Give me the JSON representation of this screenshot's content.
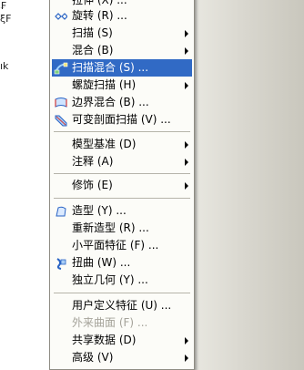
{
  "background": {
    "fragments": [
      "₣",
      "ξF",
      "ık"
    ]
  },
  "menu": {
    "items": [
      {
        "label": "拉伸 (X) ...",
        "icon": "sweep-icon",
        "submenu": false
      },
      {
        "label": "旋转 (R) ...",
        "icon": "revolve-icon",
        "submenu": false
      },
      {
        "label": "扫描 (S)",
        "icon": "",
        "submenu": true
      },
      {
        "label": "混合 (B)",
        "icon": "",
        "submenu": true
      },
      {
        "label": "扫描混合 (S) ...",
        "icon": "swept-blend-icon",
        "submenu": false,
        "highlighted": true
      },
      {
        "label": "螺旋扫描 (H)",
        "icon": "",
        "submenu": true
      },
      {
        "label": "边界混合 (B) ...",
        "icon": "boundary-blend-icon",
        "submenu": false
      },
      {
        "label": "可变剖面扫描 (V) ...",
        "icon": "variable-section-sweep-icon",
        "submenu": false
      },
      {
        "label": "模型基准 (D)",
        "icon": "",
        "submenu": true
      },
      {
        "label": "注释 (A)",
        "icon": "",
        "submenu": true
      },
      {
        "label": "修饰 (E)",
        "icon": "",
        "submenu": true
      },
      {
        "label": "造型 (Y) ...",
        "icon": "style-icon",
        "submenu": false
      },
      {
        "label": "重新造型 (R) ...",
        "icon": "",
        "submenu": false
      },
      {
        "label": "小平面特征 (F) ...",
        "icon": "",
        "submenu": false
      },
      {
        "label": "扭曲 (W) ...",
        "icon": "warp-icon",
        "submenu": false
      },
      {
        "label": "独立几何 (Y) ...",
        "icon": "",
        "submenu": false
      },
      {
        "label": "用户定义特征 (U) ...",
        "icon": "",
        "submenu": false
      },
      {
        "label": "外来曲面 (F) ...",
        "icon": "",
        "submenu": false,
        "disabled": true
      },
      {
        "label": "共享数据 (D)",
        "icon": "",
        "submenu": true
      },
      {
        "label": "高级 (V)",
        "icon": "",
        "submenu": true
      }
    ]
  },
  "colors": {
    "highlight": "#316ac5",
    "disabled_text": "#a5a39a",
    "menu_bg": "#fcfcf8"
  }
}
